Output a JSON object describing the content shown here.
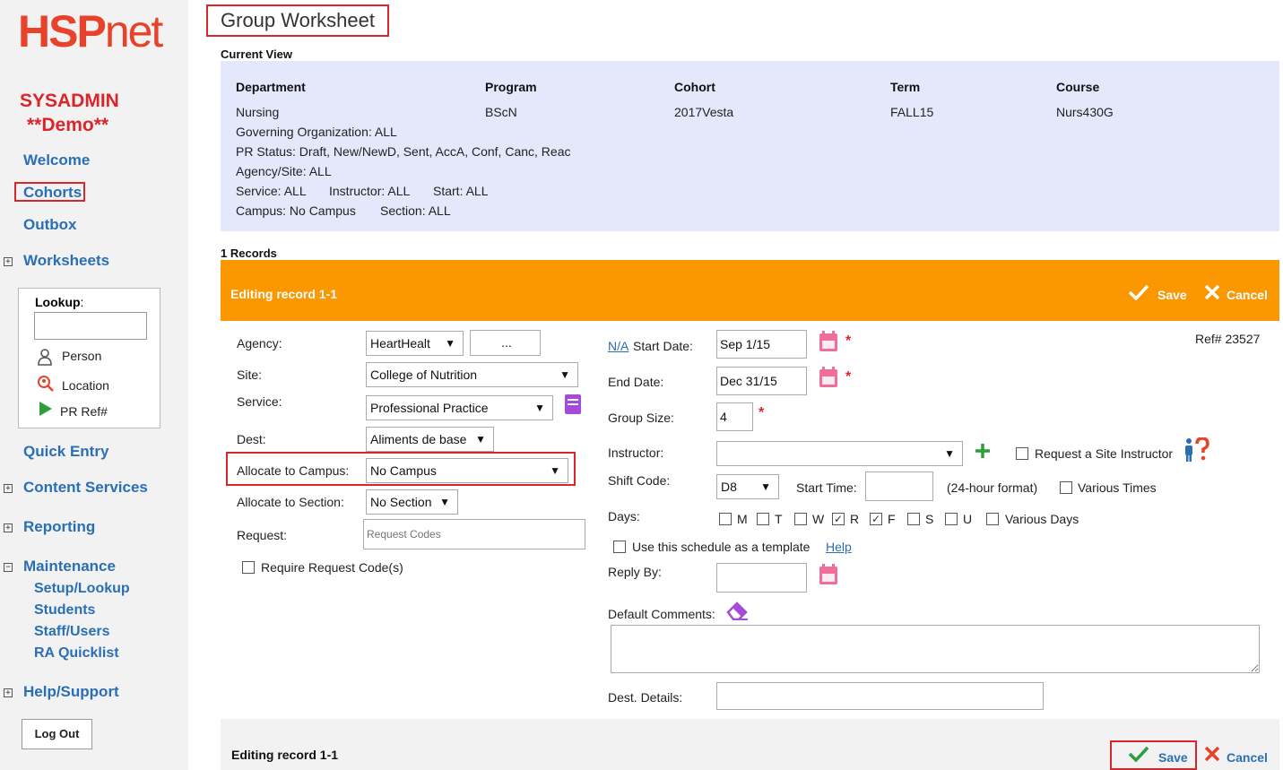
{
  "brand": {
    "logo_main": "HSP",
    "logo_tail": "net",
    "role": "SYSADMIN",
    "mode": "**Demo**",
    "color": "#e8432a"
  },
  "sidebar": {
    "welcome": "Welcome",
    "cohorts": "Cohorts",
    "outbox": "Outbox",
    "worksheets": "Worksheets",
    "lookup": {
      "title": "Lookup",
      "colon": ":",
      "person": "Person",
      "location": "Location",
      "pr_ref": "PR Ref#"
    },
    "quick_entry": "Quick Entry",
    "content_services": "Content Services",
    "reporting": "Reporting",
    "maintenance": "Maintenance",
    "maintenance_items": [
      "Setup/Lookup",
      "Students",
      "Staff/Users",
      "RA Quicklist"
    ],
    "help_support": "Help/Support",
    "logout": "Log Out",
    "expand_plus": "+",
    "expand_minus": "−"
  },
  "page": {
    "title": "Group Worksheet",
    "current_view": "Current View",
    "records": "1 Records"
  },
  "view": {
    "headers": [
      "Department",
      "Program",
      "Cohort",
      "Term",
      "Course"
    ],
    "values": [
      "Nursing",
      "BScN",
      "2017Vesta",
      "FALL15",
      "Nurs430G"
    ],
    "governing": "Governing Organization: ALL",
    "pr_status": "PR Status: Draft, New/NewD, Sent, AccA, Conf, Canc, Reac",
    "agency_site": "Agency/Site: ALL",
    "service": "Service: ALL",
    "instructor": "Instructor: ALL",
    "start": "Start: ALL",
    "campus": "Campus: No Campus",
    "section": "Section: ALL"
  },
  "edit": {
    "title": "Editing record 1-1",
    "save": "Save",
    "cancel": "Cancel",
    "ref": "Ref# 23527",
    "agency_label": "Agency:",
    "agency_value": "HeartHealt",
    "agency_more": "...",
    "site_label": "Site:",
    "site_value": "College of Nutrition",
    "service_label": "Service:",
    "service_value": "Professional Practice",
    "dest_label": "Dest:",
    "dest_value": "Aliments de base",
    "campus_label": "Allocate to Campus:",
    "campus_value": "No Campus",
    "section_label": "Allocate to Section:",
    "section_value": "No Section",
    "request_label": "Request:",
    "request_placeholder": "Request Codes",
    "require_code": "Require Request Code(s)",
    "na_link": "N/A",
    "start_date_label": "Start Date:",
    "start_date": "Sep 1/15",
    "end_date_label": "End Date:",
    "end_date": "Dec 31/15",
    "group_size_label": "Group Size:",
    "group_size": "4",
    "instructor_label": "Instructor:",
    "instructor_value": "",
    "request_site_instructor": "Request a Site Instructor",
    "shift_code_label": "Shift Code:",
    "shift_code": "D8",
    "start_time_label": "Start Time:",
    "start_time": "",
    "time_format": "(24-hour format)",
    "various_times": "Various Times",
    "days_label": "Days:",
    "days": [
      {
        "label": "M",
        "checked": false
      },
      {
        "label": "T",
        "checked": false
      },
      {
        "label": "W",
        "checked": false
      },
      {
        "label": "R",
        "checked": true
      },
      {
        "label": "F",
        "checked": true
      },
      {
        "label": "S",
        "checked": false
      },
      {
        "label": "U",
        "checked": false
      }
    ],
    "various_days": "Various Days",
    "template_label": "Use this schedule as a template",
    "help": "Help",
    "reply_by_label": "Reply By:",
    "reply_by": "",
    "default_comments_label": "Default Comments:",
    "default_comments": "",
    "dest_details_label": "Dest. Details:",
    "dest_details": "",
    "required_mark": "*",
    "check_mark": "✓",
    "dropdown_arrow": "▼"
  },
  "footer": {
    "title": "Editing record 1-1",
    "save": "Save",
    "cancel": "Cancel"
  },
  "colors": {
    "accent_orange": "#fb9701",
    "link_blue": "#2a6fb6",
    "highlight_red": "#d9262a",
    "view_bg": "#e3e9fb",
    "save_green": "#2e9e3c"
  },
  "icons": [
    "person-icon",
    "location-search-icon",
    "play-icon",
    "book-icon",
    "calendar-icon",
    "plus-icon",
    "help-person-icon",
    "eraser-icon",
    "checkmark-icon",
    "close-icon",
    "expand-icon"
  ]
}
